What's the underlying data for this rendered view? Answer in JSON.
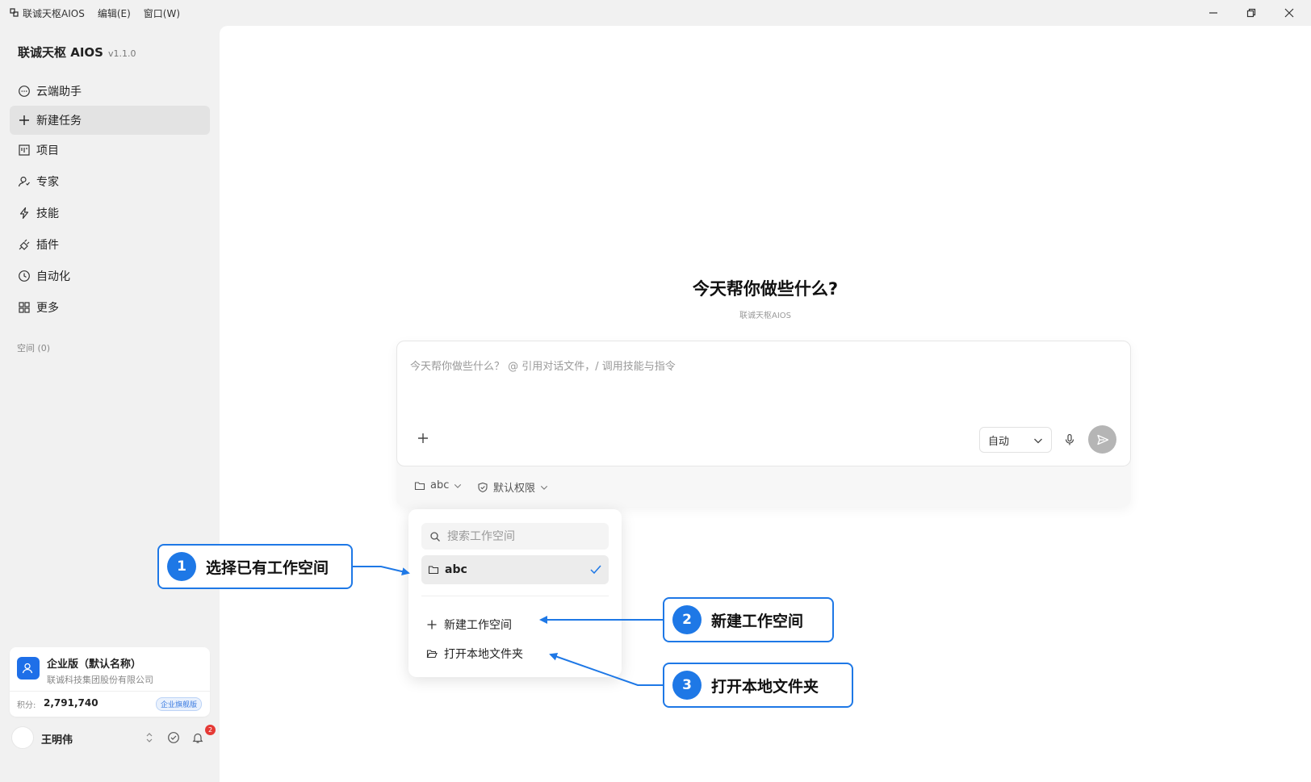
{
  "titlebar": {
    "app_name": "联诚天枢AIOS",
    "menus": [
      "编辑(E)",
      "窗口(W)"
    ]
  },
  "sidebar": {
    "brand": "联诚天枢 AIOS",
    "version": "v1.1.0",
    "items": [
      {
        "label": "云端助手",
        "icon": "chat-bubble-icon"
      },
      {
        "label": "新建任务",
        "icon": "plus-icon",
        "active": true
      },
      {
        "label": "项目",
        "icon": "project-board-icon"
      },
      {
        "label": "专家",
        "icon": "expert-user-icon"
      },
      {
        "label": "技能",
        "icon": "lightning-icon"
      },
      {
        "label": "插件",
        "icon": "plug-icon"
      },
      {
        "label": "自动化",
        "icon": "clock-icon"
      },
      {
        "label": "更多",
        "icon": "grid-icon"
      }
    ],
    "section_label": "空间 (0)",
    "enterprise": {
      "title": "企业版（默认名称）",
      "company": "联诚科技集团股份有限公司",
      "points_label": "积分:",
      "points": "2,791,740",
      "badge": "企业旗舰版"
    },
    "user": {
      "name": "王明伟",
      "notification_count": "2"
    }
  },
  "main": {
    "heading": "今天帮你做些什么?",
    "subheading": "联诚天枢AIOS",
    "composer": {
      "placeholder": "今天帮你做些什么？ @ 引用对话文件，/ 调用技能与指令",
      "mode": "自动"
    },
    "workspace_selector": "abc",
    "permission_selector": "默认权限",
    "dropdown": {
      "search_placeholder": "搜索工作空间",
      "selected_workspace": "abc",
      "new_workspace": "新建工作空间",
      "open_local_folder": "打开本地文件夹"
    }
  },
  "callouts": [
    {
      "num": "1",
      "label": "选择已有工作空间"
    },
    {
      "num": "2",
      "label": "新建工作空间"
    },
    {
      "num": "3",
      "label": "打开本地文件夹"
    }
  ],
  "colors": {
    "accent": "#1e78e6",
    "sidebar_bg": "#f1f1f1",
    "active_item_bg": "#e3e3e3",
    "send_button": "#b5b5b5",
    "notification_badge": "#e53935"
  }
}
